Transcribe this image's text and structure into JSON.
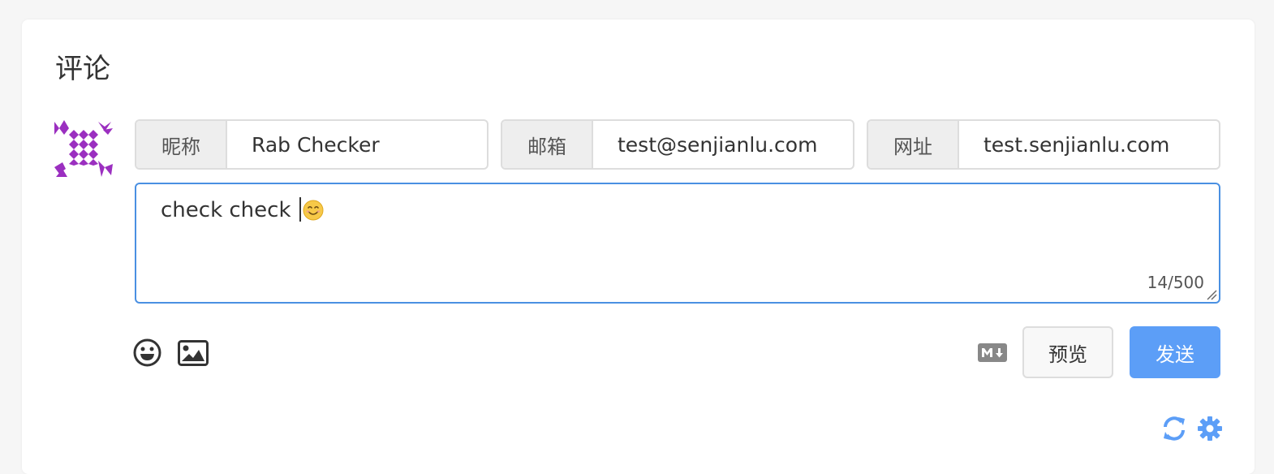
{
  "section": {
    "title": "评论"
  },
  "fields": {
    "nickname": {
      "label": "昵称",
      "value": "Rab Checker"
    },
    "email": {
      "label": "邮箱",
      "value": "test@senjianlu.com"
    },
    "website": {
      "label": "网址",
      "value": "test.senjianlu.com"
    }
  },
  "editor": {
    "text": "check check ",
    "emoji": "smiling-face-emoji",
    "counter": "14/500"
  },
  "toolbar": {
    "emoji_icon": "smile-icon",
    "image_icon": "image-icon",
    "markdown_icon": "markdown-icon",
    "preview_label": "预览",
    "send_label": "发送"
  },
  "footer": {
    "refresh_icon": "refresh-icon",
    "settings_icon": "gear-icon"
  },
  "colors": {
    "accent": "#5c9ef7",
    "focus_border": "#4a90e2",
    "avatar": "#9b2fc0"
  }
}
